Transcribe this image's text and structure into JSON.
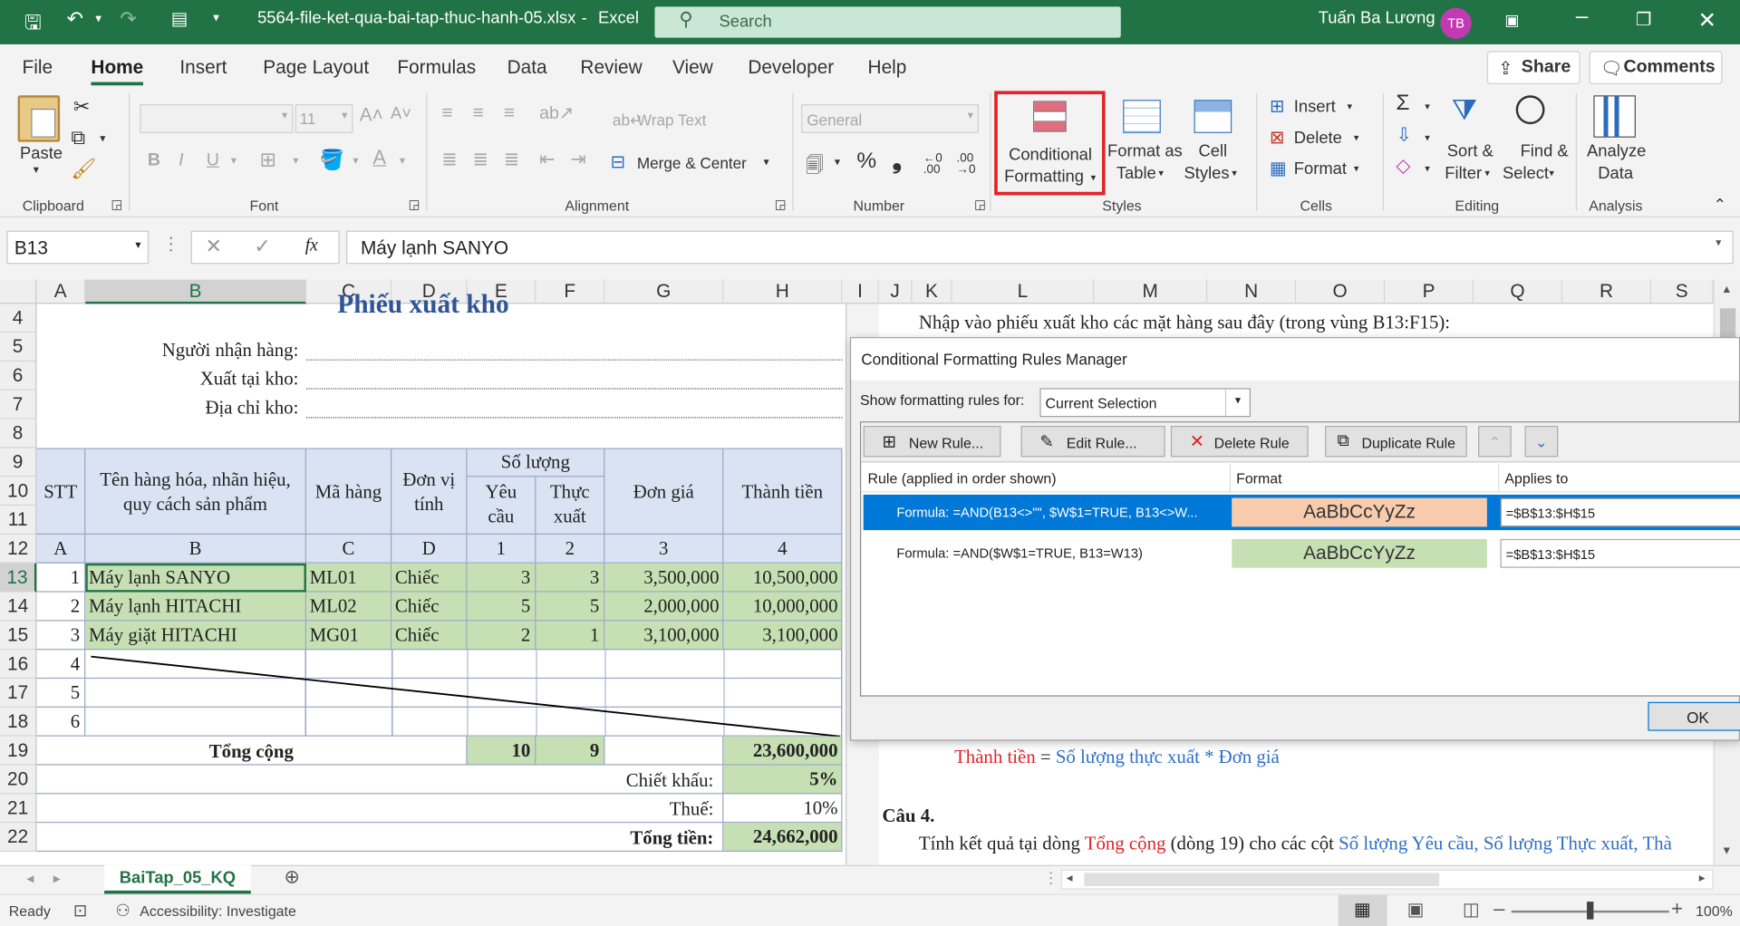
{
  "window": {
    "filename": "5564-file-ket-qua-bai-tap-thuc-hanh-05.xlsx",
    "sep": "-",
    "app": "Excel",
    "search_placeholder": "Search",
    "user": "Tuấn Ba Lương",
    "initials": "TB"
  },
  "menu": {
    "items": [
      "File",
      "Home",
      "Insert",
      "Page Layout",
      "Formulas",
      "Data",
      "Review",
      "View",
      "Developer",
      "Help"
    ],
    "share": "Share",
    "comments": "Comments"
  },
  "ribbon": {
    "clipboard": {
      "paste": "Paste",
      "label": "Clipboard"
    },
    "font": {
      "size": "11",
      "bold": "B",
      "italic": "I",
      "underline": "U",
      "label": "Font"
    },
    "alignment": {
      "wrap": "Wrap Text",
      "merge": "Merge & Center",
      "label": "Alignment"
    },
    "number": {
      "format": "General",
      "percent": "%",
      "comma": "❟",
      "label": "Number"
    },
    "styles": {
      "cf_line1": "Conditional",
      "cf_line2": "Formatting",
      "fat_line1": "Format as",
      "fat_line2": "Table",
      "cs_line1": "Cell",
      "cs_line2": "Styles",
      "label": "Styles"
    },
    "cells": {
      "insert": "Insert",
      "delete": "Delete",
      "format": "Format",
      "label": "Cells"
    },
    "editing": {
      "sort1": "Sort &",
      "sort2": "Filter",
      "find1": "Find &",
      "find2": "Select",
      "label": "Editing"
    },
    "analysis": {
      "a1": "Analyze",
      "a2": "Data",
      "label": "Analysis"
    }
  },
  "formula_bar": {
    "name_box": "B13",
    "fx": "fx",
    "value": "Máy lạnh SANYO"
  },
  "columns": [
    "A",
    "B",
    "C",
    "D",
    "E",
    "F",
    "G",
    "H",
    "I",
    "J",
    "K",
    "L",
    "M",
    "N",
    "O",
    "P",
    "Q",
    "R",
    "S"
  ],
  "rows": [
    "4",
    "5",
    "6",
    "7",
    "8",
    "9",
    "10",
    "11",
    "12",
    "13",
    "14",
    "15",
    "16",
    "17",
    "18",
    "19",
    "20",
    "21",
    "22"
  ],
  "sheet": {
    "title": "Phiếu xuất kho",
    "receiver": "Người nhận hàng:",
    "warehouse": "Xuất tại kho:",
    "address": "Địa chỉ kho:",
    "headers": {
      "stt": "STT",
      "name_l1": "Tên hàng hóa, nhãn hiệu,",
      "name_l2": "quy cách sản phẩm",
      "code": "Mã hàng",
      "unit_l1": "Đơn vị",
      "unit_l2": "tính",
      "qty": "Số lượng",
      "req_l1": "Yêu",
      "req_l2": "cầu",
      "act_l1": "Thực",
      "act_l2": "xuất",
      "price": "Đơn giá",
      "total": "Thành tiền"
    },
    "subheaders": [
      "A",
      "B",
      "C",
      "D",
      "1",
      "2",
      "3",
      "4"
    ],
    "items": [
      {
        "stt": "1",
        "name": "Máy lạnh SANYO",
        "code": "ML01",
        "unit": "Chiếc",
        "req": "3",
        "act": "3",
        "price": "3,500,000",
        "total": "10,500,000"
      },
      {
        "stt": "2",
        "name": "Máy lạnh HITACHI",
        "code": "ML02",
        "unit": "Chiếc",
        "req": "5",
        "act": "5",
        "price": "2,000,000",
        "total": "10,000,000"
      },
      {
        "stt": "3",
        "name": "Máy giặt HITACHI",
        "code": "MG01",
        "unit": "Chiếc",
        "req": "2",
        "act": "1",
        "price": "3,100,000",
        "total": "3,100,000"
      }
    ],
    "empty_stt": [
      "4",
      "5",
      "6"
    ],
    "sum_label": "Tổng cộng",
    "sum_req": "10",
    "sum_act": "9",
    "sum_total": "23,600,000",
    "discount_label": "Chiết khấu:",
    "discount": "5%",
    "tax_label": "Thuế:",
    "tax": "10%",
    "grand_label": "Tổng tiền:",
    "grand": "24,662,000"
  },
  "right_text": {
    "intro": "Nhập vào phiếu xuất kho các mặt hàng sau đây (trong vùng B13:F15):",
    "f_red": "Thành tiền",
    "f_eq": " = ",
    "f_blue": "Số lượng thực xuất * Đơn giá",
    "q4": "Câu 4.",
    "l1": "Tính kết quả tại dòng ",
    "l_red": "Tổng cộng",
    "l2": " (dòng 19) cho các cột ",
    "l_blue": "Số lượng Yêu cầu, Số lượng Thực xuất, Thà"
  },
  "dialog": {
    "title": "Conditional Formatting Rules Manager",
    "show_label": "Show formatting rules for:",
    "show_value": "Current Selection",
    "new_rule": "New Rule...",
    "edit_rule": "Edit Rule...",
    "delete_rule": "Delete Rule",
    "duplicate_rule": "Duplicate Rule",
    "col_rule": "Rule (applied in order shown)",
    "col_format": "Format",
    "col_applies": "Applies to",
    "rules": [
      {
        "formula": "Formula: =AND(B13<>\"\", $W$1=TRUE, B13<>W...",
        "preview": "AaBbCcYyZz",
        "applies": "=$B$13:$H$15",
        "color": "#f8cbad"
      },
      {
        "formula": "Formula: =AND($W$1=TRUE, B13=W13)",
        "preview": "AaBbCcYyZz",
        "applies": "=$B$13:$H$15",
        "color": "#c6e0b4"
      }
    ],
    "ok": "OK"
  },
  "tabs": {
    "sheet": "BaiTap_05_KQ"
  },
  "status": {
    "ready": "Ready",
    "accessibility": "Accessibility: Investigate",
    "zoom": "100%"
  }
}
